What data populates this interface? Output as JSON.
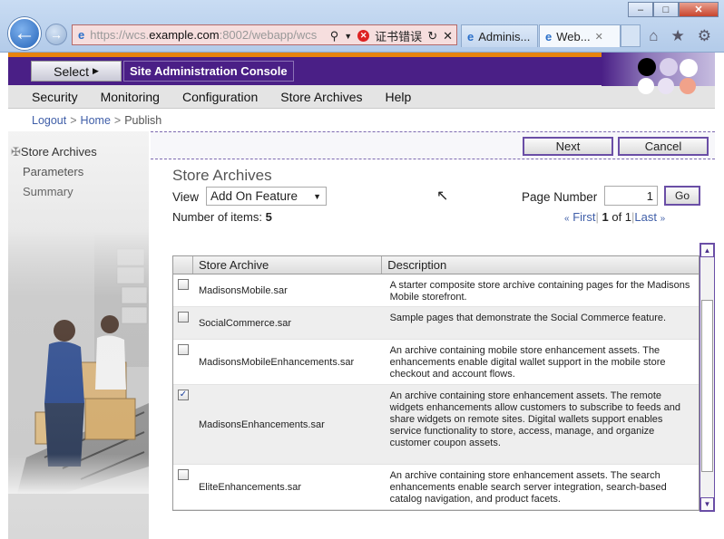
{
  "browser": {
    "address_prefix": "https://wcs.",
    "address_host": "example.com",
    "address_suffix": ":8002/webapp/wcs",
    "cert_error": "证书错误",
    "tabs": [
      {
        "label": "Adminis..."
      },
      {
        "label": "Web..."
      }
    ],
    "close_tab": "✕"
  },
  "app": {
    "select_label": "Select",
    "console_title": "Site Administration Console",
    "menu": [
      "Security",
      "Monitoring",
      "Configuration",
      "Store Archives",
      "Help"
    ],
    "breadcrumb": {
      "logout": "Logout",
      "home": "Home",
      "current": "Publish"
    }
  },
  "sidebar": {
    "items": [
      "Store Archives",
      "Parameters",
      "Summary"
    ]
  },
  "actions": {
    "next": "Next",
    "cancel": "Cancel"
  },
  "main": {
    "heading": "Store Archives",
    "view_label": "View",
    "view_value": "Add On Feature",
    "items_label": "Number of items:",
    "items_count": "5",
    "page_number_label": "Page Number",
    "page_number_value": "1",
    "go": "Go",
    "pager": {
      "first": "First",
      "current": "1",
      "of": "of 1",
      "last": "Last"
    }
  },
  "table": {
    "columns": [
      "Store Archive",
      "Description"
    ],
    "rows": [
      {
        "name": "MadisonsMobile.sar",
        "desc": "A starter composite store archive containing pages for the Madisons Mobile storefront.",
        "checked": false
      },
      {
        "name": "SocialCommerce.sar",
        "desc": "Sample pages that demonstrate the Social Commerce feature.",
        "checked": false
      },
      {
        "name": "MadisonsMobileEnhancements.sar",
        "desc": "An archive containing mobile store enhancement assets. The enhancements enable digital wallet support in the mobile store checkout and account flows.",
        "checked": false
      },
      {
        "name": "MadisonsEnhancements.sar",
        "desc": "An archive containing store enhancement assets. The remote widgets enhancements allow customers to subscribe to feeds and share widgets on remote sites. Digital wallets support enables service functionality to store, access, manage, and organize customer coupon assets.",
        "checked": true
      },
      {
        "name": "EliteEnhancements.sar",
        "desc": "An archive containing store enhancement assets. The search enhancements enable search server integration, search-based catalog navigation, and product facets.",
        "checked": false
      }
    ]
  },
  "colors": {
    "accent": "#4a1f86",
    "orange": "#e8830d",
    "link": "#3f5ea8"
  }
}
